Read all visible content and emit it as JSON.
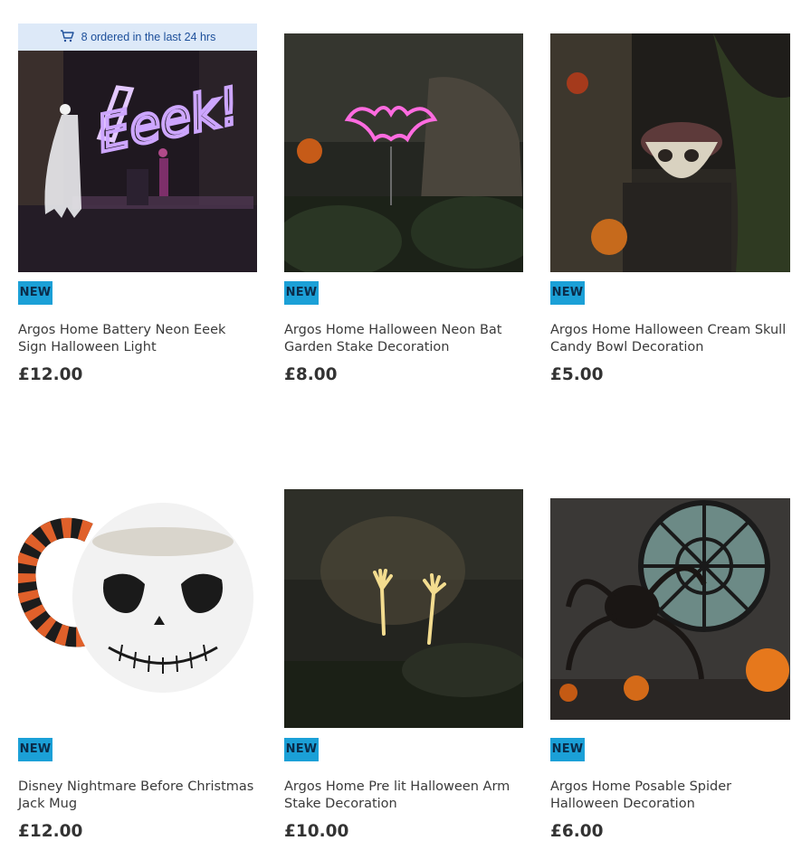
{
  "ordered_strip": {
    "icon": "cart-icon",
    "text": "8 ordered in the last 24 hrs"
  },
  "products": [
    {
      "badge": "NEW",
      "title": "Argos Home Battery Neon Eeek Sign Halloween Light",
      "price": "£12.00",
      "image": "neon-eeek-sign-image"
    },
    {
      "badge": "NEW",
      "title": "Argos Home Halloween Neon Bat Garden Stake Decoration",
      "price": "£8.00",
      "image": "neon-bat-stake-image"
    },
    {
      "badge": "NEW",
      "title": "Argos Home Halloween Cream Skull Candy Bowl Decoration",
      "price": "£5.00",
      "image": "skull-candy-bowl-image"
    },
    {
      "badge": "NEW",
      "title": "Disney Nightmare Before Christmas Jack Mug",
      "price": "£12.00",
      "image": "jack-mug-image"
    },
    {
      "badge": "NEW",
      "title": "Argos Home Pre lit Halloween Arm Stake Decoration",
      "price": "£10.00",
      "image": "arm-stake-image"
    },
    {
      "badge": "NEW",
      "title": "Argos Home Posable Spider Halloween Decoration",
      "price": "£6.00",
      "image": "posable-spider-image"
    }
  ],
  "colors": {
    "badge_bg": "#1ba0d7",
    "badge_text": "#0b2c4a",
    "strip_bg": "#dde9f8",
    "strip_text": "#1d4f9a"
  }
}
